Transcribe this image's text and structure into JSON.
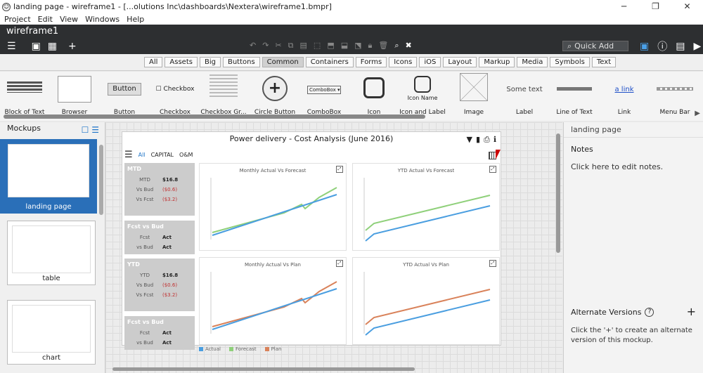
{
  "window": {
    "title": "landing page - wireframe1 - [...olutions Inc\\dashboards\\Nextera\\wireframe1.bmpr]"
  },
  "menu": [
    "Project",
    "Edit",
    "View",
    "Windows",
    "Help"
  ],
  "doc": {
    "name": "wireframe1"
  },
  "quickadd": {
    "label": "Quick Add"
  },
  "libtabs": [
    "All",
    "Assets",
    "Big",
    "Buttons",
    "Common",
    "Containers",
    "Forms",
    "Icons",
    "iOS",
    "Layout",
    "Markup",
    "Media",
    "Symbols",
    "Text"
  ],
  "libtabs_active": "Common",
  "library": [
    {
      "label": "Block of Text"
    },
    {
      "label": "Browser"
    },
    {
      "label": "Button",
      "preview": "Button"
    },
    {
      "label": "Checkbox",
      "preview": "Checkbox"
    },
    {
      "label": "Checkbox Gr..."
    },
    {
      "label": "Circle Button"
    },
    {
      "label": "ComboBox",
      "preview": "ComboBox"
    },
    {
      "label": "Icon"
    },
    {
      "label": "Icon and Label",
      "preview": "Icon Name"
    },
    {
      "label": "Image"
    },
    {
      "label": "Label",
      "preview": "Some text"
    },
    {
      "label": "Line of Text"
    },
    {
      "label": "Link",
      "preview": "a link"
    },
    {
      "label": "Menu Bar"
    }
  ],
  "mockups": {
    "title": "Mockups",
    "items": [
      {
        "label": "landing page"
      },
      {
        "label": "table"
      },
      {
        "label": "chart"
      }
    ]
  },
  "wireframe": {
    "title": "Power delivery - Cost Analysis (June 2016)",
    "tabs": [
      "All",
      "CAPITAL",
      "O&M"
    ],
    "cards": [
      {
        "head": "MTD",
        "rows": [
          {
            "k": "MTD",
            "v": "$16.8"
          },
          {
            "k": "Vs Bud",
            "v": "($0.6)"
          },
          {
            "k": "Vs Fcst",
            "v": "($3.2)"
          }
        ]
      },
      {
        "head": "Fcst vs Bud",
        "rows": [
          {
            "k": "Fcst",
            "v": "Act"
          },
          {
            "k": "vs Bud",
            "v": "Act"
          }
        ]
      },
      {
        "head": "YTD",
        "rows": [
          {
            "k": "YTD",
            "v": "$16.8"
          },
          {
            "k": "Vs Bud",
            "v": "($0.6)"
          },
          {
            "k": "Vs Fcst",
            "v": "($3.2)"
          }
        ]
      },
      {
        "head": "Fcst vs Bud",
        "rows": [
          {
            "k": "Fcst",
            "v": "Act"
          },
          {
            "k": "vs Bud",
            "v": "Act"
          }
        ]
      }
    ],
    "charts": [
      {
        "title": "Monthly Actual Vs Forecast"
      },
      {
        "title": "YTD Actual Vs Forecast"
      },
      {
        "title": "Monthly Actual Vs Plan"
      },
      {
        "title": "YTD Actual Vs Plan"
      }
    ],
    "legend": [
      "Actual",
      "Forecast",
      "Plan"
    ],
    "colors": {
      "actual": "#4a9ee0",
      "forecast": "#8fd07a",
      "plan": "#d9825a"
    }
  },
  "notes": {
    "page_title": "landing page",
    "heading": "Notes",
    "body": "Click here to edit notes.",
    "alt_heading": "Alternate Versions",
    "alt_help": "?",
    "alt_body": "Click the '+' to create an alternate version of this mockup."
  }
}
